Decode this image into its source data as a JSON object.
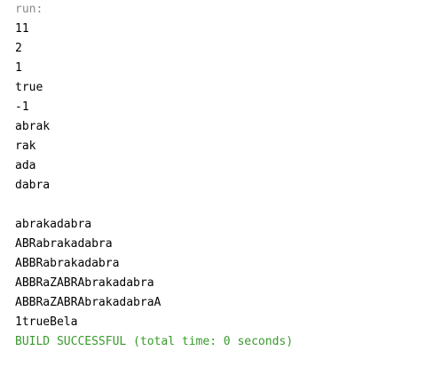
{
  "console": {
    "header": "run:",
    "lines": [
      "11",
      "2",
      "1",
      "true",
      "-1",
      "abrak",
      "rak",
      "ada",
      "dabra",
      "",
      "abrakadabra",
      "ABRabrakadabra",
      "ABBRabrakadabra",
      "ABBRaZABRAbrakadabra",
      "ABBRaZABRAbrakadabraA",
      "1trueBela"
    ],
    "build_result": "BUILD SUCCESSFUL (total time: 0 seconds)"
  },
  "colors": {
    "header": "#8a8a8a",
    "output": "#000000",
    "success": "#3a9a2e"
  }
}
